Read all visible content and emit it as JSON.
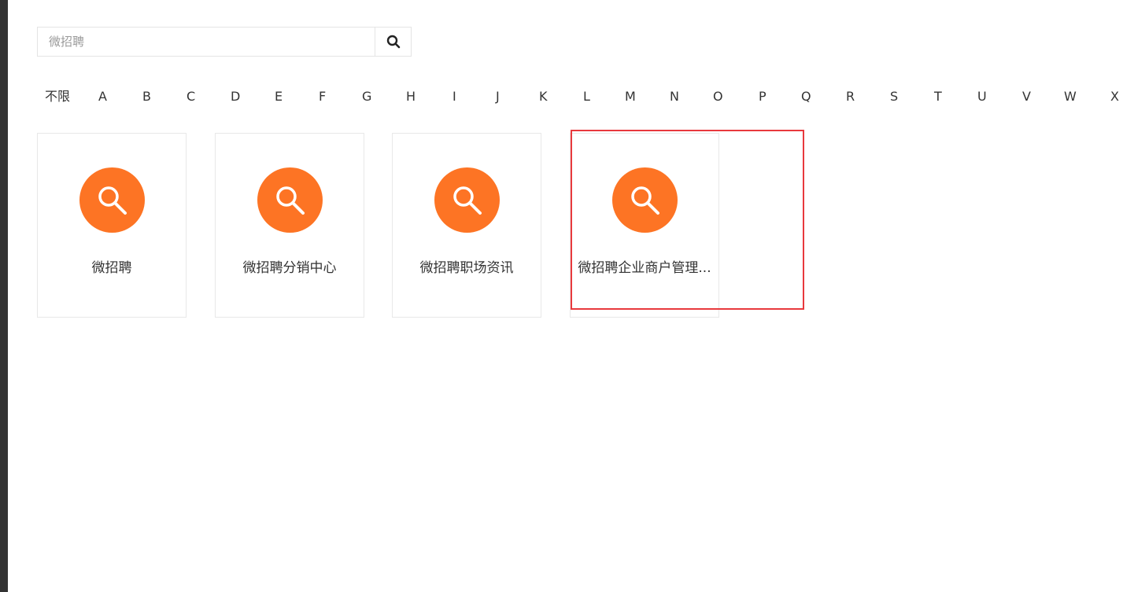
{
  "search": {
    "placeholder": "微招聘",
    "icon": "search-icon"
  },
  "letters": [
    "不限",
    "A",
    "B",
    "C",
    "D",
    "E",
    "F",
    "G",
    "H",
    "I",
    "J",
    "K",
    "L",
    "M",
    "N",
    "O",
    "P",
    "Q",
    "R",
    "S",
    "T",
    "U",
    "V",
    "W",
    "X"
  ],
  "cards": [
    {
      "label": "微招聘",
      "icon": "magnifier-icon"
    },
    {
      "label": "微招聘分销中心",
      "icon": "magnifier-icon"
    },
    {
      "label": "微招聘职场资讯",
      "icon": "magnifier-icon"
    },
    {
      "label": "微招聘企业商户管理...",
      "icon": "magnifier-icon"
    }
  ],
  "colors": {
    "icon_bg": "#fd7424",
    "highlight": "#e8393d",
    "sidebar": "#333333"
  }
}
